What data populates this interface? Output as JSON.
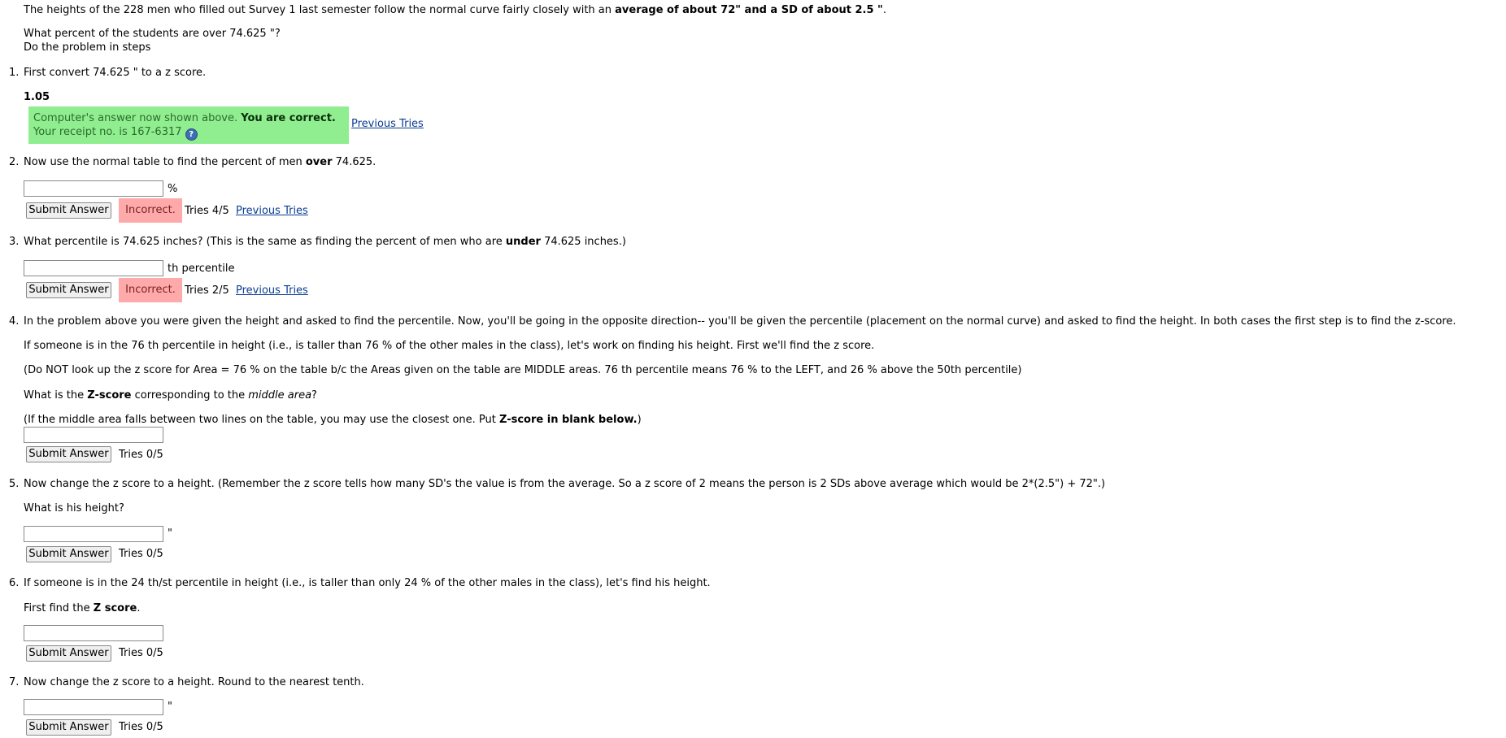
{
  "intro": {
    "text_before": "The heights of the 228 men who filled out Survey 1 last semester follow the normal curve fairly closely with an ",
    "text_bold": "average of about 72\" and a SD of about 2.5 \"",
    "text_after": "."
  },
  "question": {
    "line1": "What percent of the students are over 74.625 \"?",
    "line2": "Do the problem in steps"
  },
  "step1": {
    "number": "1.",
    "text": "First convert 74.625 \" to a z score.",
    "answer": "1.05",
    "feedback_normal": "Computer's answer now shown above. ",
    "feedback_bold": "You are correct.",
    "receipt": "Your receipt no. is 167-6317",
    "help_icon": "?",
    "previous_tries": "Previous Tries"
  },
  "step2": {
    "number": "2.",
    "text_before": "Now use the normal table to find the percent of men ",
    "text_bold": "over",
    "text_after": " 74.625.",
    "input_value": "",
    "unit": "%",
    "submit": "Submit Answer",
    "status": "Incorrect.",
    "tries": "Tries 4/5",
    "previous_tries": "Previous Tries"
  },
  "step3": {
    "number": "3.",
    "text_before": "What percentile is 74.625 inches? (This is the same as finding the percent of men who are ",
    "text_bold": "under",
    "text_after": " 74.625 inches.)",
    "input_value": "",
    "unit": "th percentile",
    "submit": "Submit Answer",
    "status": "Incorrect.",
    "tries": "Tries 2/5",
    "previous_tries": "Previous Tries"
  },
  "step4": {
    "number": "4.",
    "text": "In the problem above you were given the height and asked to find the percentile. Now, you'll be going in the opposite direction-- you'll be given the percentile (placement on the normal curve) and asked to find the height. In both cases the first step is to find the z-score.",
    "para2": "If someone is in the 76 th percentile in height (i.e., is taller than 76 % of the other males in the class), let's work on finding his height. First we'll find the z score.",
    "para3": "(Do NOT look up the z score for Area = 76 % on the table b/c the Areas given on the table are MIDDLE areas. 76 th percentile means 76 % to the LEFT, and 26 % above the 50th percentile)",
    "para4_before": "What is the ",
    "para4_bold": "Z-score",
    "para4_mid": " corresponding to the ",
    "para4_italic": "middle area",
    "para4_after": "?",
    "para5_before": "(If the middle area falls between two lines on the table, you may use the closest one. Put ",
    "para5_bold": "Z-score in blank below.",
    "para5_after": ")",
    "input_value": "",
    "submit": "Submit Answer",
    "tries": "Tries 0/5"
  },
  "step5": {
    "number": "5.",
    "text": "Now change the z score to a height. (Remember the z score tells how many SD's the value is from the average. So a z score of 2 means the person is 2 SDs above average which would be 2*(2.5\") + 72\".)",
    "para2": "What is his height?",
    "input_value": "",
    "unit": "\"",
    "submit": "Submit Answer",
    "tries": "Tries 0/5"
  },
  "step6": {
    "number": "6.",
    "text": "If someone is in the 24 th/st percentile in height (i.e., is taller than only 24 % of the other males in the class), let's find his height.",
    "para2_before": "First find the ",
    "para2_bold": "Z score",
    "para2_after": ".",
    "input_value": "",
    "submit": "Submit Answer",
    "tries": "Tries 0/5"
  },
  "step7": {
    "number": "7.",
    "text": "Now change the z score to a height. Round to the nearest tenth.",
    "input_value": "",
    "unit": "\"",
    "submit": "Submit Answer",
    "tries": "Tries 0/5"
  },
  "colors": {
    "correct_bg": "#90ee90",
    "incorrect_bg": "#ffaaaa",
    "link": "#0a3d91"
  }
}
